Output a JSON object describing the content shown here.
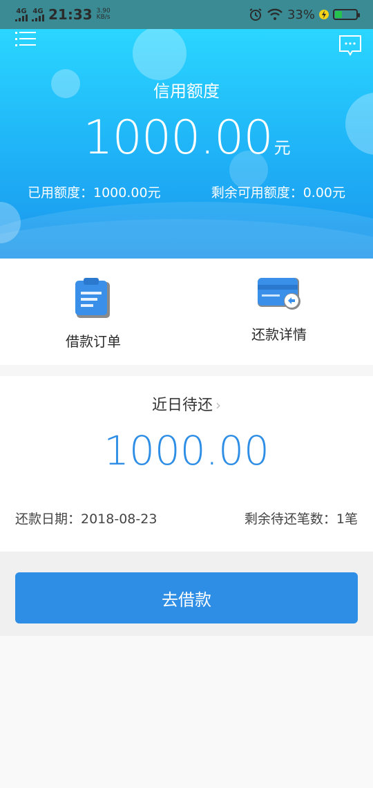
{
  "status_bar": {
    "network1": "4G",
    "network2": "4G",
    "time": "21:33",
    "speed_value": "3.90",
    "speed_unit": "KB/s",
    "battery_percent": "33%",
    "battery_level": 0.33
  },
  "hero": {
    "credit_label": "信用额度",
    "credit_amount": "1000.00",
    "credit_unit": "元",
    "used_text": "已用额度：1000.00元",
    "remaining_text": "剩余可用额度：0.00元"
  },
  "quick_actions": [
    {
      "label": "借款订单",
      "icon": "clipboard-icon"
    },
    {
      "label": "还款详情",
      "icon": "card-icon"
    }
  ],
  "due": {
    "title": "近日待还",
    "amount": "1000.00",
    "date_text": "还款日期：2018-08-23",
    "count_text": "剩余待还笔数：1笔"
  },
  "actions": {
    "borrow_label": "去借款"
  },
  "colors": {
    "accent": "#2e8ee6",
    "hero_top": "#2ad6ff",
    "hero_bottom": "#1a96ec",
    "status_bar": "#3b8b94"
  }
}
